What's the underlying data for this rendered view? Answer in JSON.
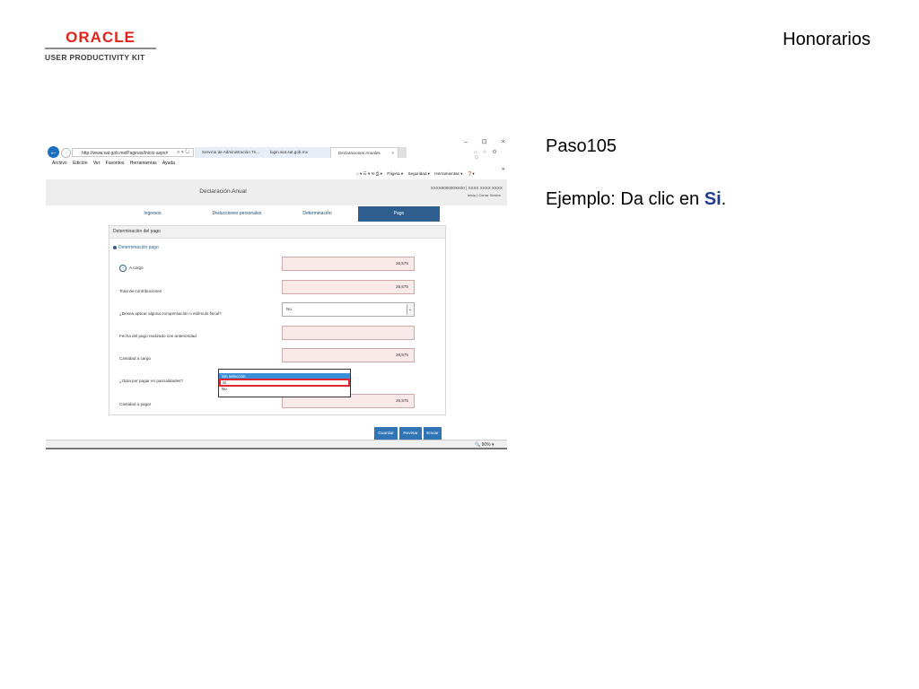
{
  "slide": {
    "logo_oracle": "ORACLE",
    "logo_upk": "USER PRODUCTIVITY KIT",
    "title": "Honorarios",
    "step": "Paso105",
    "instruction_prefix": "Ejemplo: Da clic en ",
    "instruction_target": "Si",
    "instruction_suffix": "."
  },
  "browser": {
    "address": "http://www.sat.gob.mx/Paginas/Inicio.aspx#",
    "tabs": [
      {
        "label": "Servicio de Administración Tri..."
      },
      {
        "label": "login.siat.sat.gob.mx"
      },
      {
        "label": "Declaraciones Anuales",
        "close": "×"
      }
    ],
    "window_controls": "–  ⊡  ×",
    "menu": [
      "Archivo",
      "Edición",
      "Ver",
      "Favoritos",
      "Herramientas",
      "Ayuda"
    ],
    "commands": [
      "Página ▾",
      "Seguridad ▾",
      "Herramientas ▾"
    ],
    "more": "»",
    "zoom": "🔍 90% ▾"
  },
  "app": {
    "title": "Declaración Anual",
    "rfc": "XXXX000000XX00 | XXXX XXXX XXXX",
    "user_links": "Inicio | Cerrar Sesión",
    "tabs": [
      "Ingresos",
      "Deducciones personales",
      "Determinación",
      "Pago"
    ],
    "active_tab": "Pago",
    "panel_title": "Determinación del pago",
    "section_title": "Determinación pago",
    "rows": [
      {
        "label": "A cargo",
        "value": "26,575"
      },
      {
        "label": "Total de contribuciones",
        "value": "26,575"
      },
      {
        "label": "¿Desea aplicar alguna compensación o estímulo fiscal?",
        "value": "No"
      },
      {
        "label": "Fecha del pago realizado con anterioridad",
        "value": ""
      },
      {
        "label": "Cantidad a cargo",
        "value": "26,575"
      },
      {
        "label": "¿Opta por pagar en parcialidades?",
        "value": ""
      },
      {
        "label": "Cantidad a pagar",
        "value": "26,575"
      }
    ],
    "dropdown_options": [
      "Sin selección",
      "Si",
      "No"
    ],
    "dropdown_selected": "Sin selección",
    "dropdown_highlight": "Si",
    "buttons": [
      "Guardar",
      "Revisar",
      "Enviar"
    ]
  }
}
